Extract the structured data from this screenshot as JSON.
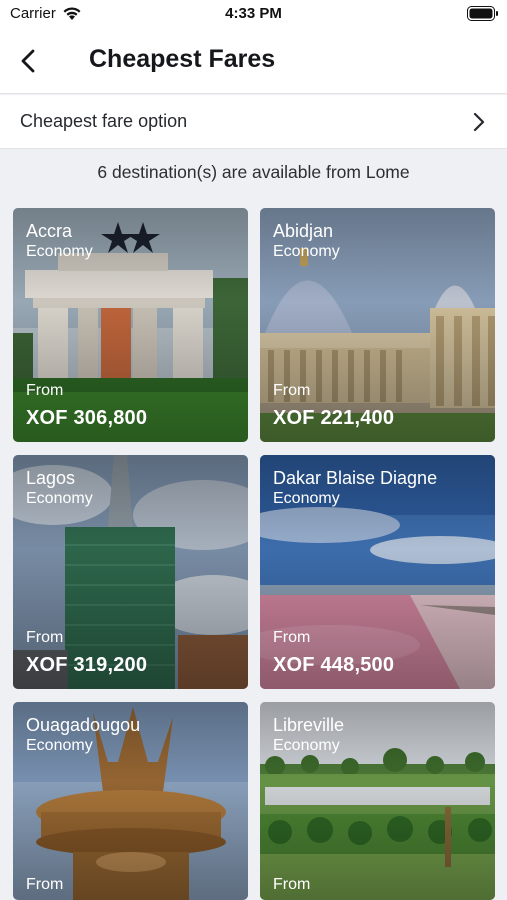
{
  "status_bar": {
    "carrier": "Carrier",
    "time": "4:33 PM"
  },
  "nav": {
    "title": "Cheapest Fares"
  },
  "option_row": {
    "label": "Cheapest fare option"
  },
  "summary": "6 destination(s) are available from Lome",
  "destinations": [
    {
      "city": "Accra",
      "cabin": "Economy",
      "from_label": "From",
      "price": "XOF 306,800"
    },
    {
      "city": "Abidjan",
      "cabin": "Economy",
      "from_label": "From",
      "price": "XOF 221,400"
    },
    {
      "city": "Lagos",
      "cabin": "Economy",
      "from_label": "From",
      "price": "XOF 319,200"
    },
    {
      "city": "Dakar Blaise Diagne",
      "cabin": "Economy",
      "from_label": "From",
      "price": "XOF 448,500"
    },
    {
      "city": "Ouagadougou",
      "cabin": "Economy",
      "from_label": "From",
      "price": ""
    },
    {
      "city": "Libreville",
      "cabin": "Economy",
      "from_label": "From",
      "price": ""
    }
  ],
  "icons": {
    "back": "chevron-left-icon",
    "row_chevron": "chevron-right-icon",
    "wifi": "wifi-icon",
    "battery": "battery-icon"
  },
  "colors": {
    "background": "#eef0f3",
    "surface": "#ffffff",
    "text": "#15171a"
  }
}
